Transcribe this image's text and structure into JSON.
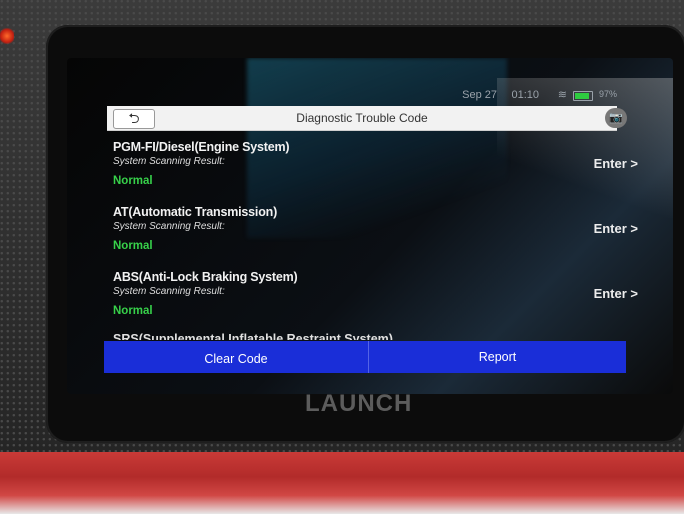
{
  "status_bar": {
    "date": "Sep 27",
    "time": "01:10",
    "battery": "97%"
  },
  "header": {
    "back_icon": "back-arrow-icon",
    "title": "Diagnostic Trouble Code",
    "camera_icon": "camera-icon"
  },
  "systems": [
    {
      "name": "PGM-FI/Diesel(Engine System)",
      "scan_label": "System Scanning Result:",
      "status": "Normal",
      "action": "Enter >"
    },
    {
      "name": "AT(Automatic Transmission)",
      "scan_label": "System Scanning Result:",
      "status": "Normal",
      "action": "Enter >"
    },
    {
      "name": "ABS(Anti-Lock Braking System)",
      "scan_label": "System Scanning Result:",
      "status": "Normal",
      "action": "Enter >"
    }
  ],
  "partial_system_name": "SRS(Supplemental Inflatable Restraint System)",
  "footer": {
    "clear_code_label": "Clear Code",
    "report_label": "Report"
  },
  "brand": "LAUNCH",
  "colors": {
    "status_normal": "#37d14a",
    "button_bar": "#1a2ed8",
    "device_trim": "#c93a37"
  }
}
